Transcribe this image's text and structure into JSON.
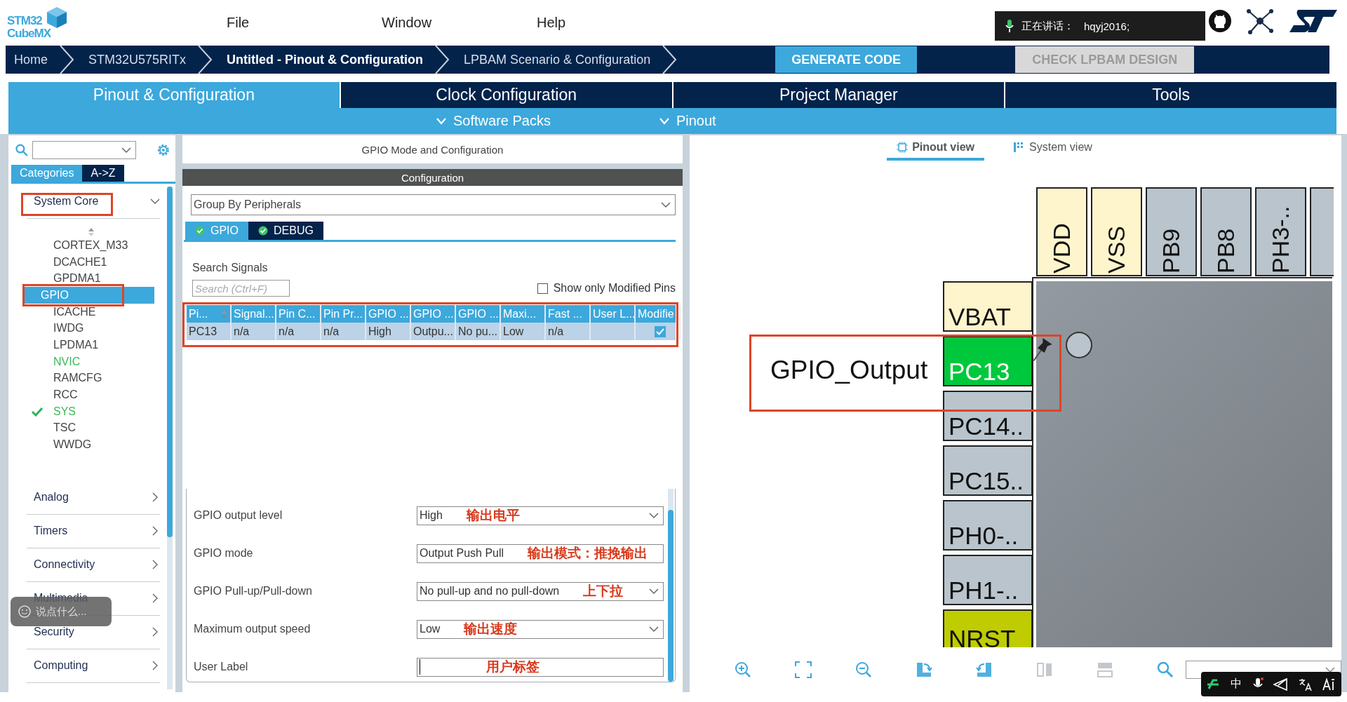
{
  "app": {
    "logo_top": "STM32",
    "logo_bottom": "CubeMX"
  },
  "menu": [
    "File",
    "Window",
    "Help"
  ],
  "speaking_popup": {
    "label": "正在讲话：",
    "user": "hqyj2016;"
  },
  "breadcrumbs": [
    {
      "label": "Home",
      "selected": false
    },
    {
      "label": "STM32U575RITx",
      "selected": false
    },
    {
      "label": "Untitled - Pinout & Configuration",
      "selected": true
    },
    {
      "label": "LPBAM Scenario & Configuration",
      "selected": false
    }
  ],
  "actions": [
    {
      "label": "GENERATE CODE",
      "disabled": false
    },
    {
      "label": "CHECK LPBAM DESIGN",
      "disabled": true
    }
  ],
  "main_tabs": [
    {
      "label": "Pinout & Configuration",
      "selected": true
    },
    {
      "label": "Clock Configuration",
      "selected": false
    },
    {
      "label": "Project Manager",
      "selected": false
    },
    {
      "label": "Tools",
      "selected": false
    }
  ],
  "sub_menus": [
    "Software Packs",
    "Pinout"
  ],
  "sidebar": {
    "tabs": [
      {
        "label": "Categories",
        "selected": true
      },
      {
        "label": "A->Z",
        "selected": false
      }
    ],
    "categories": [
      {
        "label": "System Core",
        "expanded": true,
        "annotated": true,
        "children": [
          {
            "label": "CORTEX_M33",
            "selected": false,
            "annotated": false,
            "kind": "plain"
          },
          {
            "label": "DCACHE1",
            "selected": false,
            "annotated": false,
            "kind": "plain"
          },
          {
            "label": "GPDMA1",
            "selected": false,
            "annotated": false,
            "kind": "plain"
          },
          {
            "label": "GPIO",
            "selected": true,
            "annotated": true,
            "kind": "plain"
          },
          {
            "label": "ICACHE",
            "selected": false,
            "annotated": false,
            "kind": "plain"
          },
          {
            "label": "IWDG",
            "selected": false,
            "annotated": false,
            "kind": "plain"
          },
          {
            "label": "LPDMA1",
            "selected": false,
            "annotated": false,
            "kind": "plain"
          },
          {
            "label": "NVIC",
            "selected": false,
            "annotated": false,
            "kind": "enabled"
          },
          {
            "label": "RAMCFG",
            "selected": false,
            "annotated": false,
            "kind": "plain"
          },
          {
            "label": "RCC",
            "selected": false,
            "annotated": false,
            "kind": "plain"
          },
          {
            "label": "SYS",
            "selected": false,
            "annotated": false,
            "kind": "configured"
          },
          {
            "label": "TSC",
            "selected": false,
            "annotated": false,
            "kind": "plain"
          },
          {
            "label": "WWDG",
            "selected": false,
            "annotated": false,
            "kind": "plain"
          }
        ]
      },
      {
        "label": "Analog",
        "expanded": false,
        "annotated": false
      },
      {
        "label": "Timers",
        "expanded": false,
        "annotated": false
      },
      {
        "label": "Connectivity",
        "expanded": false,
        "annotated": false
      },
      {
        "label": "Multimedia",
        "expanded": false,
        "annotated": false
      },
      {
        "label": "Security",
        "expanded": false,
        "annotated": false
      },
      {
        "label": "Computing",
        "expanded": false,
        "annotated": false
      }
    ]
  },
  "chat_bubble": {
    "placeholder": "说点什么..."
  },
  "config": {
    "title": "GPIO Mode and Configuration",
    "section": "Configuration",
    "group_by": "Group By Peripherals",
    "tabs": [
      {
        "label": "GPIO",
        "selected": true
      },
      {
        "label": "DEBUG",
        "selected": false
      }
    ],
    "search_label": "Search Signals",
    "search_placeholder": "Search (Ctrl+F)",
    "modified_only": {
      "label": "Show only Modified Pins",
      "checked": false
    },
    "table": {
      "annotated": true,
      "columns": [
        "Pi...",
        "Signal...",
        "Pin C...",
        "Pin Pr...",
        "GPIO ...",
        "GPIO ...",
        "GPIO ...",
        "Maxi...",
        "Fast ...",
        "User L...",
        "Modifie"
      ],
      "rows": [
        {
          "selected": true,
          "modified": true,
          "cells": [
            "PC13",
            "n/a",
            "n/a",
            "n/a",
            "High",
            "Outpu...",
            "No pu...",
            "Low",
            "n/a",
            ""
          ]
        }
      ]
    },
    "settings": [
      {
        "label": "GPIO output level",
        "value": "High",
        "kind": "dropdown",
        "note": "输出电平"
      },
      {
        "label": "GPIO mode",
        "value": "Output Push Pull",
        "kind": "text",
        "note": "输出模式：推挽输出"
      },
      {
        "label": "GPIO Pull-up/Pull-down",
        "value": "No pull-up and no pull-down",
        "kind": "dropdown",
        "note": "上下拉"
      },
      {
        "label": "Maximum output speed",
        "value": "Low",
        "kind": "dropdown",
        "note": "输出速度"
      },
      {
        "label": "User Label",
        "kind": "input",
        "note": "用户标签"
      }
    ]
  },
  "pinout": {
    "view_tabs": [
      {
        "label": "Pinout view",
        "selected": true
      },
      {
        "label": "System view",
        "selected": false
      }
    ],
    "top_pins": [
      {
        "label": "VDD",
        "kind": "power"
      },
      {
        "label": "VSS",
        "kind": "power"
      },
      {
        "label": "PB9",
        "kind": "io"
      },
      {
        "label": "PB8",
        "kind": "io"
      },
      {
        "label": "PH3-..",
        "kind": "io"
      }
    ],
    "left_pins": [
      {
        "label": "VBAT",
        "kind": "power"
      },
      {
        "label": "PC13",
        "kind": "assigned"
      },
      {
        "label": "PC14..",
        "kind": "io"
      },
      {
        "label": "PC15..",
        "kind": "io"
      },
      {
        "label": "PH0-..",
        "kind": "io"
      },
      {
        "label": "PH1-..",
        "kind": "io"
      },
      {
        "label": "NRST",
        "kind": "reset"
      }
    ],
    "pin_label": {
      "text": "GPIO_Output",
      "annotated": true
    },
    "toolbar": [
      {
        "kind": "zoom-in",
        "disabled": false
      },
      {
        "kind": "fit",
        "disabled": false
      },
      {
        "kind": "zoom-out",
        "disabled": false
      },
      {
        "kind": "rotate-right",
        "disabled": false
      },
      {
        "kind": "rotate-left",
        "disabled": false
      },
      {
        "kind": "flip-horizontal",
        "disabled": true
      },
      {
        "kind": "flip-vertical",
        "disabled": true
      },
      {
        "kind": "search",
        "disabled": false
      }
    ]
  },
  "ime_bar": {
    "mode": "中"
  }
}
